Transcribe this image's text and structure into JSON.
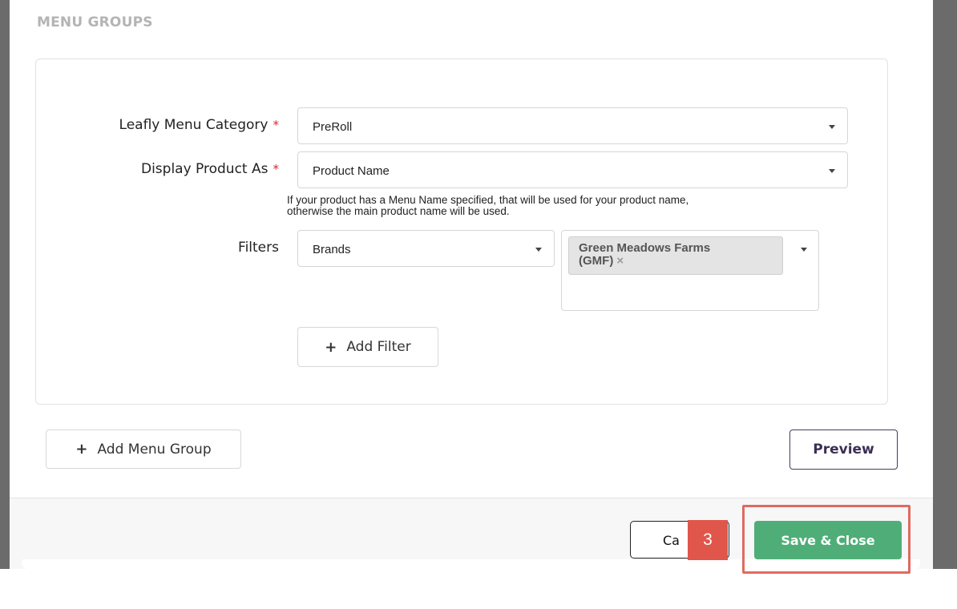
{
  "section": {
    "title": "MENU GROUPS"
  },
  "menu_group": {
    "category": {
      "label": "Leafly Menu Category",
      "required_mark": "*",
      "value": "PreRoll"
    },
    "display_as": {
      "label": "Display Product As",
      "required_mark": "*",
      "value": "Product Name",
      "help_line1": "If your product has a Menu Name specified, that will be used for your product name,",
      "help_line2": "otherwise the main product name will be used."
    },
    "filters": {
      "label": "Filters",
      "type_value": "Brands",
      "tag_line1": "Green Meadows Farms",
      "tag_line2": "(GMF)",
      "tag_remove": "×"
    },
    "add_filter_label": "Add Filter",
    "plus_glyph": "+"
  },
  "actions": {
    "add_menu_group_label": "Add Menu Group",
    "preview_label": "Preview"
  },
  "footer": {
    "cancel_label": "Ca",
    "step_badge": "3",
    "save_label": "Save & Close"
  },
  "colors": {
    "accent_green": "#4fae78",
    "highlight_red": "#e06a5f",
    "required_red": "#d42b2b"
  },
  "icons": {
    "caret": "chevron-down-icon",
    "plus": "plus-icon",
    "remove": "close-icon"
  }
}
